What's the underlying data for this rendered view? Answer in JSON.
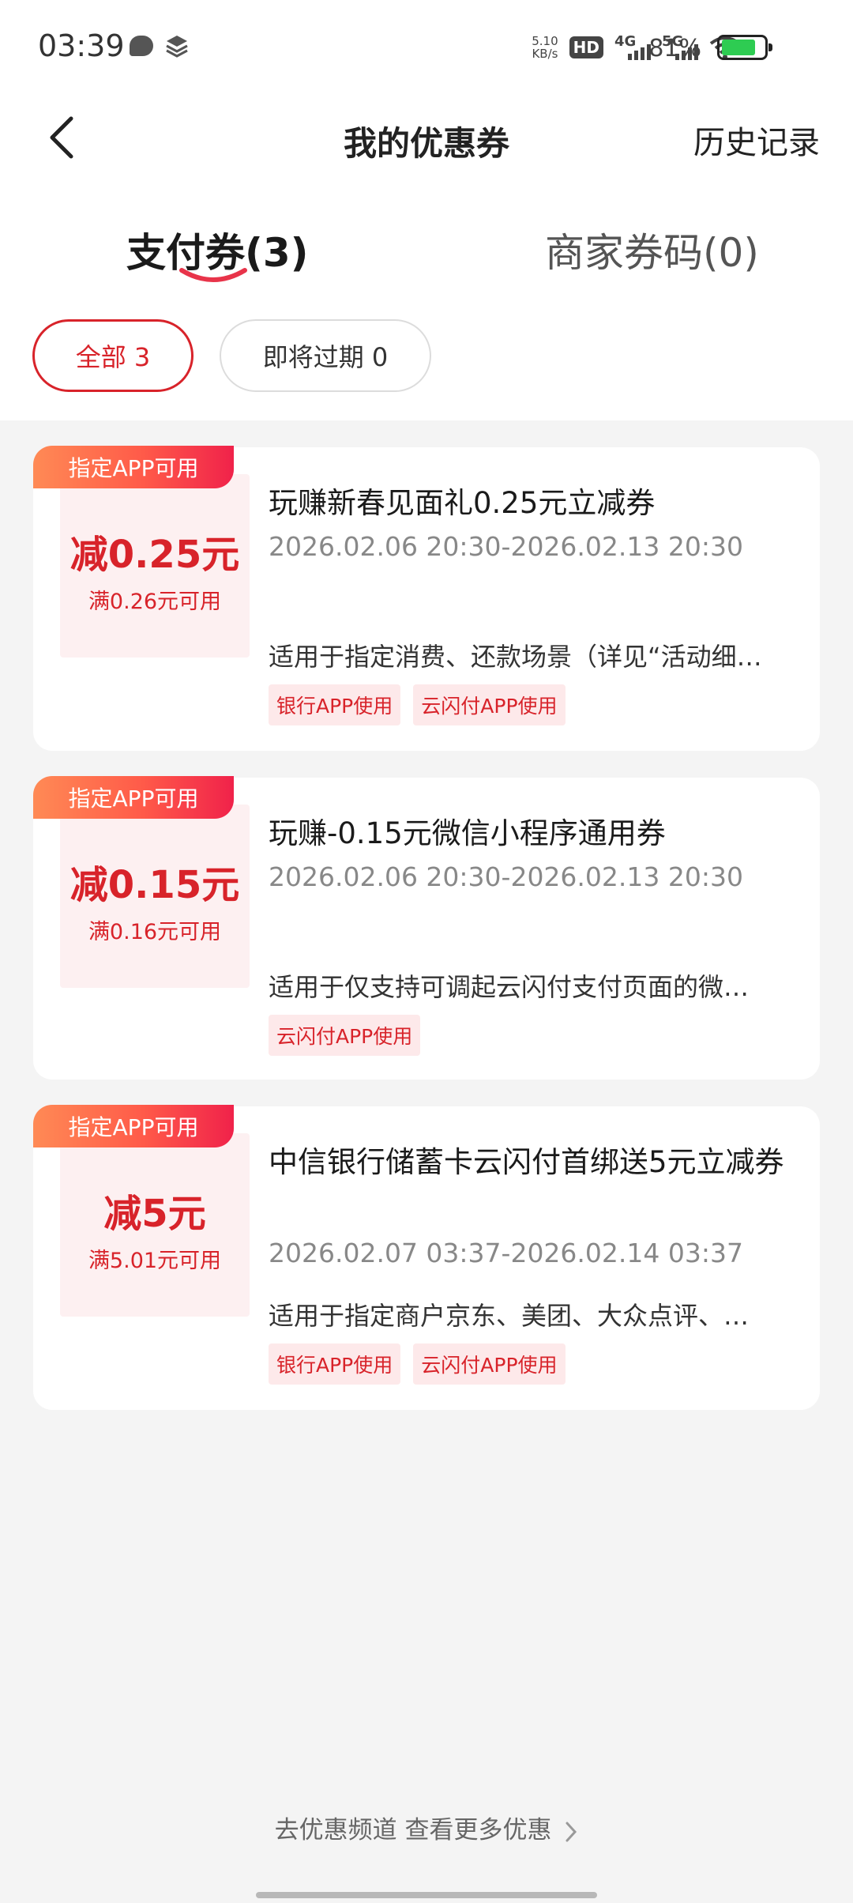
{
  "status_bar": {
    "time": "03:39",
    "net_speed_value": "5.10",
    "net_speed_unit": "KB/s",
    "hd_label": "HD",
    "net_1": "4G",
    "net_2": "5G",
    "battery_percent": "81%"
  },
  "header": {
    "title": "我的优惠券",
    "history_label": "历史记录"
  },
  "tabs": [
    {
      "label": "支付券(3)",
      "active": true
    },
    {
      "label": "商家券码(0)",
      "active": false
    }
  ],
  "filters": [
    {
      "label": "全部 3",
      "active": true
    },
    {
      "label": "即将过期 0",
      "active": false
    }
  ],
  "coupons": [
    {
      "tag": "指定APP可用",
      "amount": "减0.25元",
      "threshold": "满0.26元可用",
      "title": "玩赚新春见面礼0.25元立减券",
      "period": "2026.02.06 20:30-2026.02.13 20:30",
      "description": "适用于指定消费、还款场景（详见“活动细…",
      "badges": [
        "银行APP使用",
        "云闪付APP使用"
      ]
    },
    {
      "tag": "指定APP可用",
      "amount": "减0.15元",
      "threshold": "满0.16元可用",
      "title": "玩赚-0.15元微信小程序通用券",
      "period": "2026.02.06 20:30-2026.02.13 20:30",
      "description": "适用于仅支持可调起云闪付支付页面的微…",
      "badges": [
        "云闪付APP使用"
      ]
    },
    {
      "tag": "指定APP可用",
      "amount": "减5元",
      "threshold": "满5.01元可用",
      "title": "中信银行储蓄卡云闪付首绑送5元立减券",
      "period": "2026.02.07 03:37-2026.02.14 03:37",
      "description": "适用于指定商户京东、美团、大众点评、…",
      "badges": [
        "银行APP使用",
        "云闪付APP使用"
      ]
    }
  ],
  "footer": {
    "link_label": "去优惠频道 查看更多优惠"
  },
  "colors": {
    "accent": "#d8232a",
    "page_bg": "#f4f4f4",
    "tag_gradient_start": "#ff8a55",
    "tag_gradient_end": "#f0224a"
  }
}
